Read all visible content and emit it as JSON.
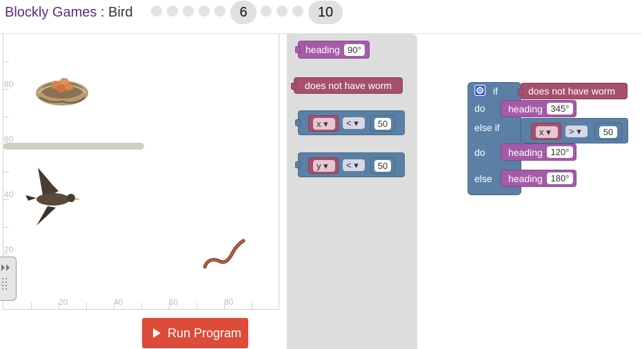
{
  "header": {
    "app_name": "Blockly Games",
    "separator": " : ",
    "game_name": "Bird",
    "levels": [
      {
        "label": "",
        "state": "done"
      },
      {
        "label": "",
        "state": "done"
      },
      {
        "label": "",
        "state": "done"
      },
      {
        "label": "",
        "state": "done"
      },
      {
        "label": "",
        "state": "done"
      },
      {
        "label": "6",
        "state": "current"
      },
      {
        "label": "",
        "state": "todo"
      },
      {
        "label": "",
        "state": "todo"
      },
      {
        "label": "",
        "state": "todo"
      },
      {
        "label": "10",
        "state": "last"
      }
    ]
  },
  "visualization": {
    "y_axis_labels": [
      "80",
      "60",
      "40",
      "20"
    ],
    "x_axis_labels": [
      "20",
      "40",
      "60",
      "80"
    ],
    "icons": [
      "nest-icon",
      "bird-icon",
      "worm-icon",
      "wall"
    ]
  },
  "run_button": {
    "label": "Run Program",
    "icon": "play-icon"
  },
  "toolbox": {
    "heading_block": {
      "label": "heading",
      "value": "90°"
    },
    "no_worm_block": {
      "label": "does not have worm"
    },
    "compare_x_block": {
      "var": "x",
      "op": "<",
      "value": "50"
    },
    "compare_y_block": {
      "var": "y",
      "op": "<",
      "value": "50"
    }
  },
  "workspace": {
    "if_label": "if",
    "condition1": "does not have worm",
    "do1_label": "do",
    "heading1": {
      "label": "heading",
      "value": "345°"
    },
    "elseif_label": "else if",
    "condition2": {
      "var": "x",
      "op": ">",
      "value": "50"
    },
    "do2_label": "do",
    "heading2": {
      "label": "heading",
      "value": "120°"
    },
    "else_label": "else",
    "heading3": {
      "label": "heading",
      "value": "180°"
    },
    "gear": "gear-icon"
  },
  "colors": {
    "purple_block": "#a55ba8",
    "maroon_block": "#a5506f",
    "blue_block": "#5b80a5",
    "run_button": "#dd4b39",
    "title": "#5a2a8c"
  }
}
